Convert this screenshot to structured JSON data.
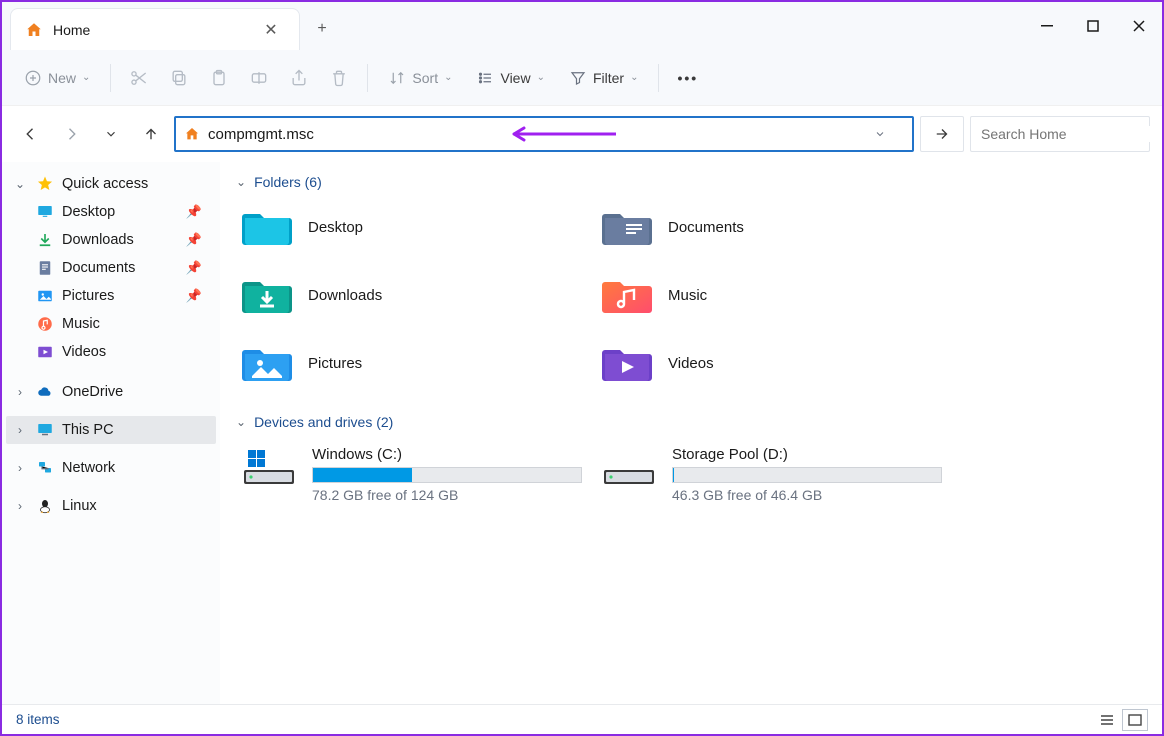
{
  "titlebar": {
    "tab_title": "Home",
    "close": "✕",
    "newtab": "+"
  },
  "toolbar": {
    "new_label": "New",
    "sort_label": "Sort",
    "view_label": "View",
    "filter_label": "Filter"
  },
  "addressbar": {
    "value": "compmgmt.msc",
    "go": "→",
    "search_placeholder": "Search Home"
  },
  "sidebar": {
    "quick_access": "Quick access",
    "desktop": "Desktop",
    "downloads": "Downloads",
    "documents": "Documents",
    "pictures": "Pictures",
    "music": "Music",
    "videos": "Videos",
    "onedrive": "OneDrive",
    "this_pc": "This PC",
    "network": "Network",
    "linux": "Linux"
  },
  "content": {
    "folders_header": "Folders (6)",
    "drives_header": "Devices and drives (2)",
    "folders": {
      "desktop": "Desktop",
      "documents": "Documents",
      "downloads": "Downloads",
      "music": "Music",
      "pictures": "Pictures",
      "videos": "Videos"
    },
    "drives": {
      "c": {
        "name": "Windows (C:)",
        "free": "78.2 GB free of 124 GB",
        "used_pct": 37
      },
      "d": {
        "name": "Storage Pool (D:)",
        "free": "46.3 GB free of 46.4 GB",
        "used_pct": 0.3
      }
    }
  },
  "statusbar": {
    "count": "8 items"
  }
}
